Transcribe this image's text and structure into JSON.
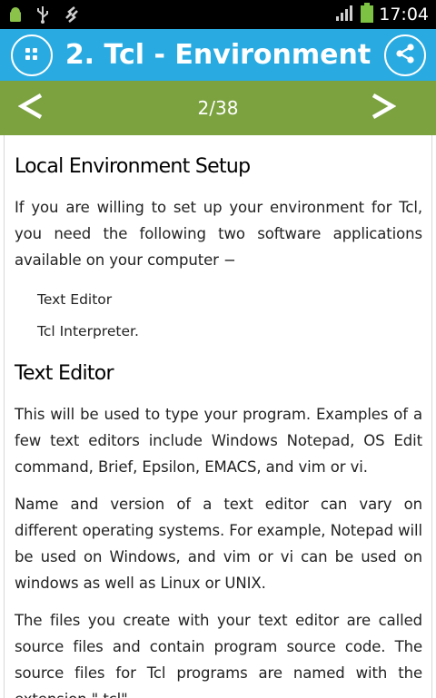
{
  "status_bar": {
    "time": "17:04",
    "icons": [
      "android-notification-icon",
      "usb-icon",
      "usb-debug-icon",
      "signal-icon",
      "battery-icon"
    ]
  },
  "app_bar": {
    "title": "2. Tcl - Environment",
    "color": "#29abe2",
    "menu_icon": "grid-menu-icon",
    "share_icon": "share-icon"
  },
  "pager": {
    "indicator": "2/38",
    "prev_icon": "chevron-left-icon",
    "next_icon": "chevron-right-icon",
    "color": "#7ba23f"
  },
  "content": {
    "heading1": "Local Environment Setup",
    "para1": "If you are willing to set up your environment for Tcl, you need the following two software applications available on your computer −",
    "list": [
      "Text Editor",
      "Tcl Interpreter."
    ],
    "heading2": "Text Editor",
    "para2": "This will be used to type your program. Examples of a few text editors include Windows Notepad, OS Edit command, Brief, Epsilon, EMACS, and vim or vi.",
    "para3": "Name and version of a text editor can vary on different operating systems. For example, Notepad will be used on Windows, and vim or vi can be used on windows as well as Linux or UNIX.",
    "para4": "The files you create with your text editor are called source files and contain program source code. The source files for Tcl programs are named with the extension \".tcl\"."
  }
}
